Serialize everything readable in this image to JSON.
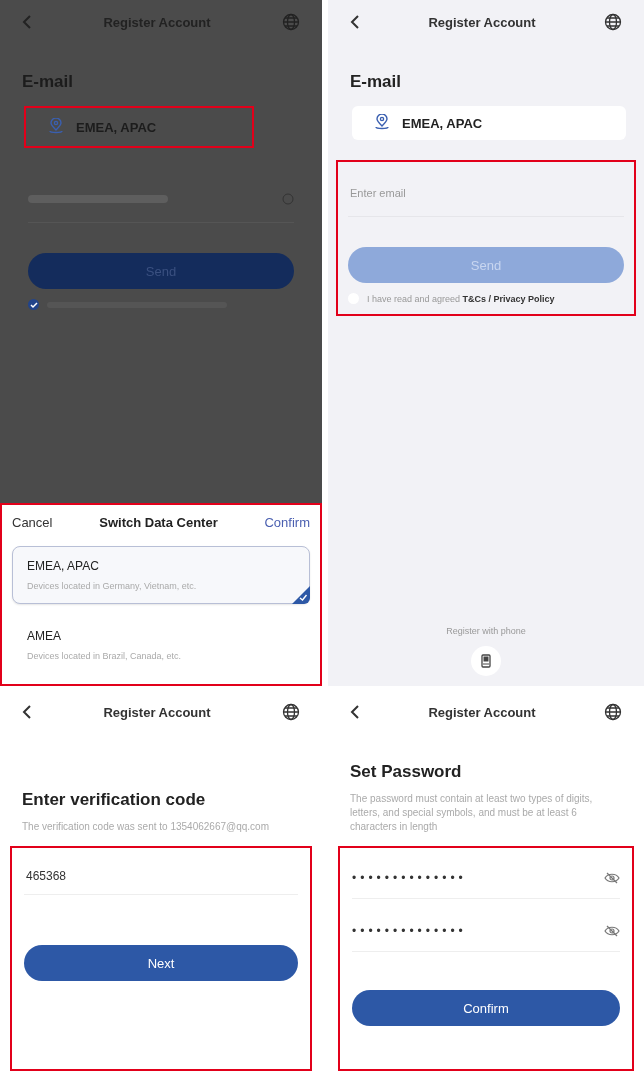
{
  "screens": [
    {
      "kind": "email",
      "dimmed": true,
      "title": "Register Account",
      "heading": "E-mail",
      "region": "EMEA, APAC",
      "email": {
        "hidden_value": true
      },
      "send_button": {
        "label": "Send",
        "disabled": false
      },
      "agreement": {
        "checked": true
      },
      "sheet": {
        "cancel": "Cancel",
        "title": "Switch Data Center",
        "confirm": "Confirm",
        "options": [
          {
            "name": "EMEA, APAC",
            "description": "Devices located in Germany, Vietnam, etc.",
            "selected": true
          },
          {
            "name": "AMEA",
            "description": "Devices located in Brazil, Canada, etc.",
            "selected": false
          }
        ]
      }
    },
    {
      "kind": "email",
      "dimmed": false,
      "title": "Register Account",
      "heading": "E-mail",
      "region": "EMEA, APAC",
      "email": {
        "placeholder": "Enter email"
      },
      "send_button": {
        "label": "Send",
        "disabled": true
      },
      "agreement": {
        "checked": false,
        "text": "I have read and agreed **T&Cs / Privacy Policy**"
      },
      "footer": {
        "label": "Register with phone"
      }
    },
    {
      "kind": "verify",
      "title": "Register Account",
      "heading": "Enter verification code",
      "subtitle": "The verification code was sent to 1354062667@qq.com",
      "code": "465368",
      "button": "Next"
    },
    {
      "kind": "password",
      "title": "Register Account",
      "heading": "Set Password",
      "subtitle": "The password must contain at least two types of digits, letters, and special symbols, and must be at least 6 characters in length",
      "passwords": [
        "••••••••••••••",
        "••••••••••••••"
      ],
      "button": "Confirm"
    }
  ]
}
